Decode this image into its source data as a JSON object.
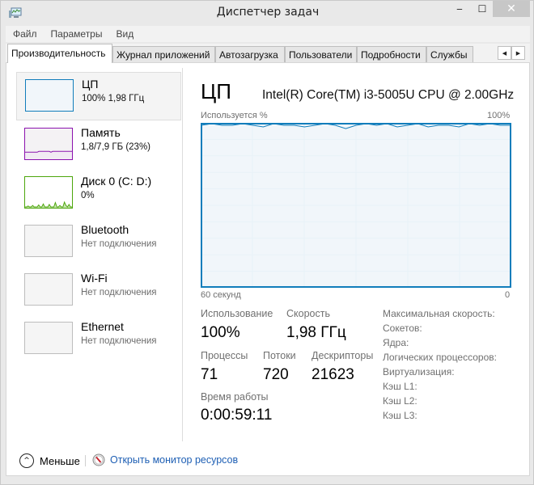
{
  "window": {
    "title": "Диспетчер задач",
    "minimize_icon": "minimize-icon",
    "maximize_icon": "maximize-icon",
    "close_icon": "close-icon",
    "minimize_glyph": "‒",
    "maximize_glyph": "☐",
    "close_glyph": "✕"
  },
  "menu": {
    "items": [
      {
        "label": "Файл"
      },
      {
        "label": "Параметры"
      },
      {
        "label": "Вид"
      }
    ]
  },
  "tabs": {
    "items": [
      {
        "label": "Производительность",
        "active": true
      },
      {
        "label": "Журнал приложений",
        "active": false
      },
      {
        "label": "Автозагрузка",
        "active": false
      },
      {
        "label": "Пользователи",
        "active": false
      },
      {
        "label": "Подробности",
        "active": false
      },
      {
        "label": "Службы",
        "active": false
      }
    ],
    "scroll_left": "◀",
    "scroll_right": "▶"
  },
  "sidebar": {
    "items": [
      {
        "name": "ЦП",
        "sub": "100%  1,98 ГГц",
        "color": "#117dbb",
        "fill": "#f1f6fa",
        "selected": true,
        "muted": false
      },
      {
        "name": "Память",
        "sub": "1,8/7,9 ГБ (23%)",
        "color": "#8b12ae",
        "fill": "#f4f2f4",
        "selected": false,
        "muted": false
      },
      {
        "name": "Диск 0 (C: D:)",
        "sub": "0%",
        "color": "#4da60c",
        "fill": "#ffffff",
        "selected": false,
        "muted": false
      },
      {
        "name": "Bluetooth",
        "sub": "Нет подключения",
        "color": "#bdbdbd",
        "fill": "#f5f5f5",
        "selected": false,
        "muted": true
      },
      {
        "name": "Wi-Fi",
        "sub": "Нет подключения",
        "color": "#bdbdbd",
        "fill": "#f5f5f5",
        "selected": false,
        "muted": true
      },
      {
        "name": "Ethernet",
        "sub": "Нет подключения",
        "color": "#bdbdbd",
        "fill": "#f5f5f5",
        "selected": false,
        "muted": true
      }
    ],
    "memory_usage_percent": 23,
    "disk_activity": [
      0,
      0,
      2,
      0,
      0,
      3,
      0,
      0,
      0,
      4,
      0,
      0,
      6,
      0,
      0,
      0,
      5,
      0,
      0,
      0,
      9,
      0,
      0,
      3,
      0,
      0,
      10,
      3,
      0,
      5,
      0,
      0
    ]
  },
  "main": {
    "title": "ЦП",
    "cpu_model": "Intel(R) Core(TM) i3-5005U CPU @ 2.00GHz",
    "accent": "#117dbb",
    "grid_color": "#d9eaf4",
    "plot_fill": "#f1f6fa"
  },
  "chart_data": {
    "type": "line",
    "title": "ЦП",
    "ylabel": "Используется %",
    "ymax_label": "100%",
    "xlabel_left": "60 секунд",
    "xlabel_right": "0",
    "ylim": [
      0,
      100
    ],
    "xlim": [
      60,
      0
    ],
    "grid": true,
    "x": [
      60,
      58,
      56,
      54,
      52,
      50,
      48,
      46,
      44,
      42,
      40,
      38,
      36,
      34,
      32,
      30,
      28,
      26,
      24,
      22,
      20,
      18,
      16,
      14,
      12,
      10,
      8,
      6,
      4,
      2,
      0
    ],
    "values": [
      99,
      100,
      99,
      99,
      100,
      99,
      98,
      100,
      99,
      99,
      98,
      99,
      100,
      99,
      97,
      99,
      100,
      99,
      100,
      98,
      99,
      100,
      98,
      99,
      99,
      98,
      100,
      99,
      100,
      99,
      99
    ]
  },
  "stats": {
    "usage_label": "Использование",
    "usage_value": "100%",
    "speed_label": "Скорость",
    "speed_value": "1,98 ГГц",
    "processes_label": "Процессы",
    "processes_value": "71",
    "threads_label": "Потоки",
    "threads_value": "720",
    "handles_label": "Дескрипторы",
    "handles_value": "21623",
    "uptime_label": "Время работы",
    "uptime_value": "0:00:59:11"
  },
  "specs": [
    {
      "label": "Максимальная скорость:"
    },
    {
      "label": "Сокетов:"
    },
    {
      "label": "Ядра:"
    },
    {
      "label": "Логических процессоров:"
    },
    {
      "label": "Виртуализация:"
    },
    {
      "label": "Кэш L1:"
    },
    {
      "label": "Кэш L2:"
    },
    {
      "label": "Кэш L3:"
    }
  ],
  "footer": {
    "less_label": "Меньше",
    "less_glyph": "^",
    "monitor_label": "Открыть монитор ресурсов",
    "link_color": "#1e5fb4"
  }
}
